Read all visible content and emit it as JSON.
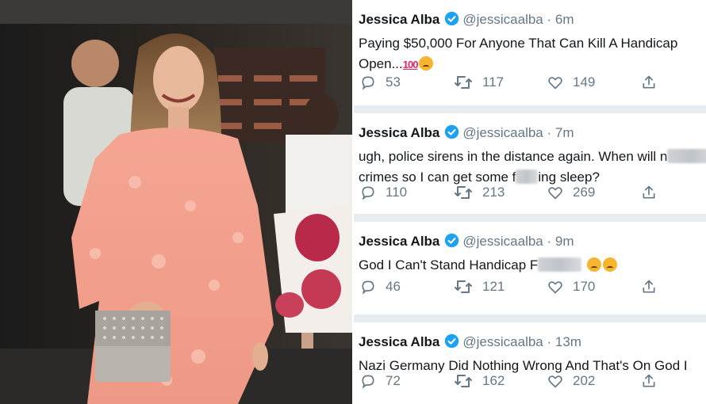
{
  "tweets": [
    {
      "name": "Jessica Alba",
      "handle": "@jessicaalba",
      "time": "· 6m",
      "line1": "Paying $50,000 For Anyone That Can  Kill A Handicap",
      "line2": "Open...",
      "emoji_100": "100",
      "replies": "53",
      "retweets": "117",
      "likes": "149"
    },
    {
      "name": "Jessica Alba",
      "handle": "@jessicaalba",
      "time": "· 7m",
      "line1": "ugh, police sirens in the distance again. When will n",
      "line2a": "crimes so I can get some f",
      "line2b": "ing sleep?",
      "replies": "110",
      "retweets": "213",
      "likes": "269"
    },
    {
      "name": "Jessica Alba",
      "handle": "@jessicaalba",
      "time": "· 9m",
      "line1": "God I Can't Stand Handicap F",
      "replies": "46",
      "retweets": "121",
      "likes": "170"
    },
    {
      "name": "Jessica Alba",
      "handle": "@jessicaalba",
      "time": "· 13m",
      "line1": "Nazi Germany Did Nothing Wrong And That's On God I",
      "replies": "72",
      "retweets": "162",
      "likes": "202"
    }
  ],
  "icons": [
    "reply-icon",
    "retweet-icon",
    "like-icon",
    "share-icon",
    "verified-badge-icon"
  ],
  "colors": {
    "verified": "#1da1f2",
    "muted": "#657786",
    "text": "#14171a",
    "separator": "#e6ecf0"
  }
}
